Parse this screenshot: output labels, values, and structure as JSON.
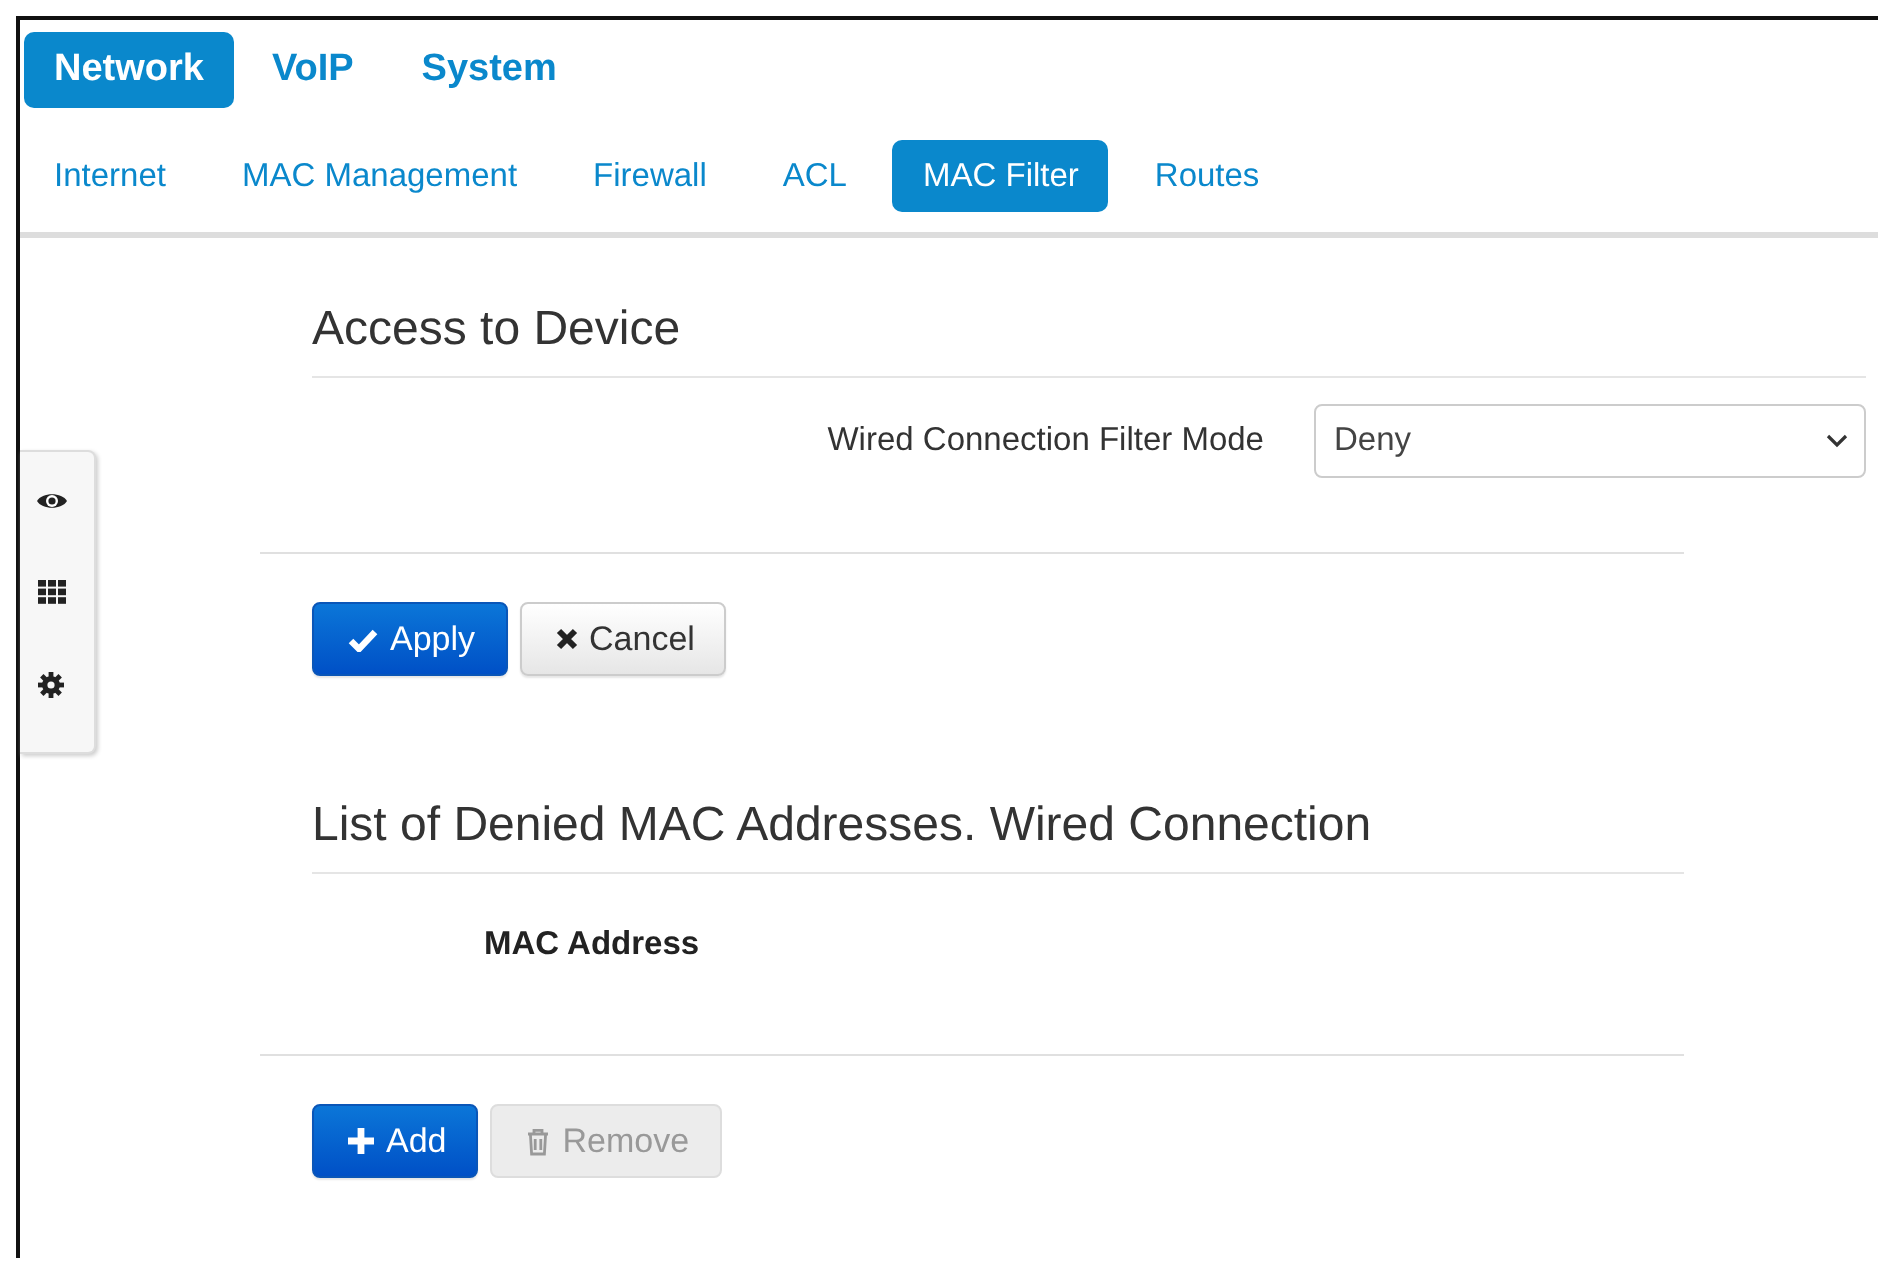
{
  "main_tabs": [
    {
      "label": "Network",
      "selected": true
    },
    {
      "label": "VoIP",
      "selected": false
    },
    {
      "label": "System",
      "selected": false
    }
  ],
  "sub_tabs": [
    {
      "label": "Internet",
      "selected": false
    },
    {
      "label": "MAC Management",
      "selected": false
    },
    {
      "label": "Firewall",
      "selected": false
    },
    {
      "label": "ACL",
      "selected": false
    },
    {
      "label": "MAC Filter",
      "selected": true
    },
    {
      "label": "Routes",
      "selected": false
    }
  ],
  "access_section": {
    "title": "Access to Device",
    "filter_mode": {
      "label": "Wired Connection Filter Mode",
      "value": "Deny"
    },
    "buttons": [
      {
        "label": "Apply",
        "kind": "apply",
        "disabled": false
      },
      {
        "label": "Cancel",
        "kind": "cancel",
        "disabled": false
      }
    ]
  },
  "list_section": {
    "title": "List of Denied MAC Addresses. Wired Connection",
    "columns": [
      "MAC Address"
    ],
    "buttons": [
      {
        "label": "Add",
        "kind": "add",
        "disabled": false
      },
      {
        "label": "Remove",
        "kind": "remove",
        "disabled": true
      }
    ]
  }
}
